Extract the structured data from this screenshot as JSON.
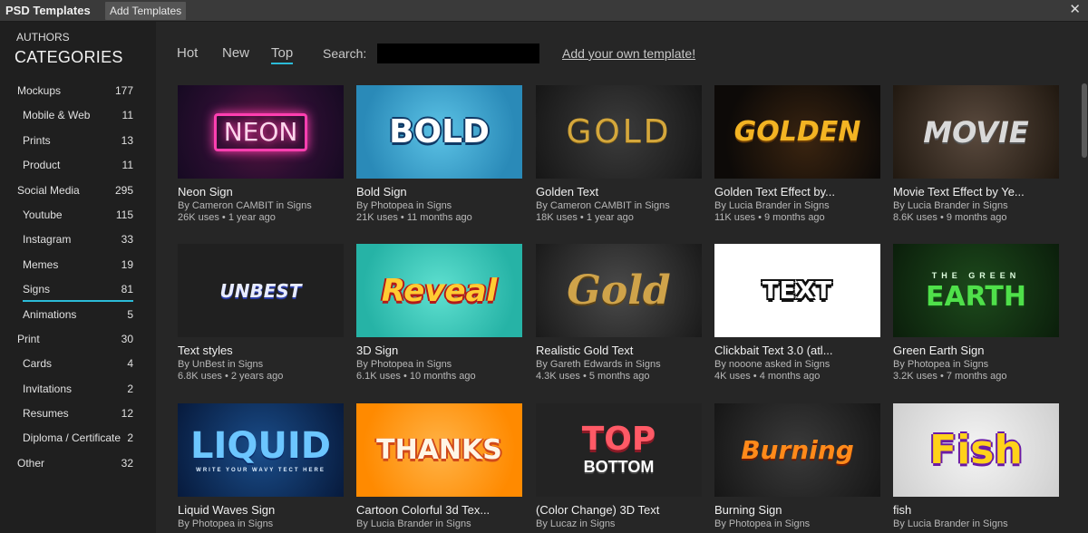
{
  "window": {
    "title": "PSD Templates",
    "tab_button": "Add Templates",
    "close_glyph": "✕"
  },
  "sidebar": {
    "authors_label": "AUTHORS",
    "categories_title": "CATEGORIES",
    "categories": [
      {
        "label": "Mockups",
        "count": "177",
        "sub": false
      },
      {
        "label": "Mobile & Web",
        "count": "11",
        "sub": true
      },
      {
        "label": "Prints",
        "count": "13",
        "sub": true
      },
      {
        "label": "Product",
        "count": "11",
        "sub": true
      },
      {
        "label": "Social Media",
        "count": "295",
        "sub": false
      },
      {
        "label": "Youtube",
        "count": "115",
        "sub": true
      },
      {
        "label": "Instagram",
        "count": "33",
        "sub": true
      },
      {
        "label": "Memes",
        "count": "19",
        "sub": true
      },
      {
        "label": "Signs",
        "count": "81",
        "sub": true,
        "active": true
      },
      {
        "label": "Animations",
        "count": "5",
        "sub": true
      },
      {
        "label": "Print",
        "count": "30",
        "sub": false
      },
      {
        "label": "Cards",
        "count": "4",
        "sub": true
      },
      {
        "label": "Invitations",
        "count": "2",
        "sub": true
      },
      {
        "label": "Resumes",
        "count": "12",
        "sub": true
      },
      {
        "label": "Diploma / Certificate",
        "count": "2",
        "sub": true
      },
      {
        "label": "Other",
        "count": "32",
        "sub": false
      }
    ]
  },
  "toolbar": {
    "tabs": [
      {
        "label": "Hot",
        "active": false
      },
      {
        "label": "New",
        "active": false
      },
      {
        "label": "Top",
        "active": true
      }
    ],
    "search_label": "Search:",
    "search_value": "",
    "add_link": "Add your own template!"
  },
  "accent_color": "#2bbbd8",
  "templates": [
    {
      "title": "Neon Sign",
      "author": "By Cameron CAMBIT in Signs",
      "uses": "26K uses • 1 year ago",
      "thumb_text": "NEON",
      "style": "t-neon"
    },
    {
      "title": "Bold Sign",
      "author": "By Photopea in Signs",
      "uses": "21K uses • 11 months ago",
      "thumb_text": "BOLD",
      "style": "t-bold"
    },
    {
      "title": "Golden Text",
      "author": "By Cameron CAMBIT in Signs",
      "uses": "18K uses • 1 year ago",
      "thumb_text": "GOLD",
      "style": "t-gold"
    },
    {
      "title": "Golden Text Effect by...",
      "author": "By Lucia Brander in Signs",
      "uses": "11K uses • 9 months ago",
      "thumb_text": "GOLDEN",
      "style": "t-golden"
    },
    {
      "title": "Movie Text Effect by Ye...",
      "author": "By Lucia Brander in Signs",
      "uses": "8.6K uses • 9 months ago",
      "thumb_text": "MOVIE",
      "style": "t-movie"
    },
    {
      "title": "Text styles",
      "author": "By UnBest in Signs",
      "uses": "6.8K uses • 2 years ago",
      "thumb_text": "UNBEST",
      "style": "t-unbest"
    },
    {
      "title": "3D Sign",
      "author": "By Photopea in Signs",
      "uses": "6.1K uses • 10 months ago",
      "thumb_text": "Reveal",
      "style": "t-reveal"
    },
    {
      "title": "Realistic Gold Text",
      "author": "By Gareth Edwards in Signs",
      "uses": "4.3K uses • 5 months ago",
      "thumb_text": "Gold",
      "style": "t-gold2"
    },
    {
      "title": "Clickbait Text 3.0 (atl...",
      "author": "By nooone asked in Signs",
      "uses": "4K uses • 4 months ago",
      "thumb_text": "TEXT",
      "style": "t-text"
    },
    {
      "title": "Green Earth Sign",
      "author": "By Photopea in Signs",
      "uses": "3.2K uses • 7 months ago",
      "thumb_text": "EARTH",
      "thumb_sub": "THE GREEN",
      "style": "t-earth"
    },
    {
      "title": "Liquid Waves Sign",
      "author": "By Photopea in Signs",
      "uses": "",
      "thumb_text": "LIQUID",
      "thumb_sub": "WRITE YOUR WAVY TECT HERE",
      "style": "t-liquid"
    },
    {
      "title": "Cartoon Colorful 3d Tex...",
      "author": "By Lucia Brander in Signs",
      "uses": "",
      "thumb_text": "THANKS",
      "style": "t-thanks"
    },
    {
      "title": "(Color Change) 3D Text",
      "author": "By Lucaz in Signs",
      "uses": "",
      "thumb_text": "TOP",
      "thumb_sub": "BOTTOM",
      "style": "t-topbottom"
    },
    {
      "title": "Burning Sign",
      "author": "By Photopea in Signs",
      "uses": "",
      "thumb_text": "Burning",
      "style": "t-burning"
    },
    {
      "title": "fish",
      "author": "By Lucia Brander in Signs",
      "uses": "",
      "thumb_text": "Fish",
      "style": "t-fish"
    }
  ]
}
